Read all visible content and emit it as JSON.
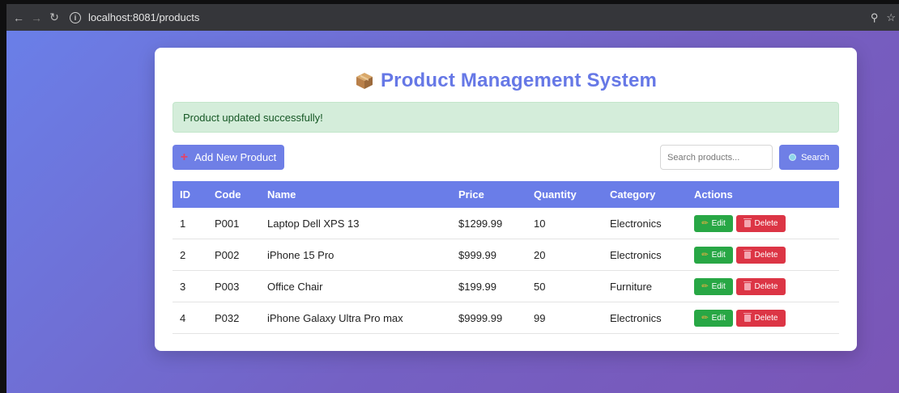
{
  "browser": {
    "url": "localhost:8081/products",
    "icons": [
      "back-arrow-icon",
      "forward-arrow-icon",
      "reload-icon",
      "info-icon",
      "zoom-icon",
      "star-icon"
    ]
  },
  "page": {
    "title": "Product Management System",
    "title_icon": "package-box-icon",
    "accent_color": "#6678e6"
  },
  "alert": {
    "message": "Product updated successfully!",
    "color": "#d4edda"
  },
  "toolbar": {
    "add_label": "Add New Product",
    "search_placeholder": "Search products...",
    "search_label": "Search"
  },
  "table": {
    "columns": [
      "ID",
      "Code",
      "Name",
      "Price",
      "Quantity",
      "Category",
      "Actions"
    ],
    "edit_label": "Edit",
    "delete_label": "Delete",
    "rows": [
      {
        "id": "1",
        "code": "P001",
        "name": "Laptop Dell XPS 13",
        "price": "$1299.99",
        "quantity": "10",
        "category": "Electronics"
      },
      {
        "id": "2",
        "code": "P002",
        "name": "iPhone 15 Pro",
        "price": "$999.99",
        "quantity": "20",
        "category": "Electronics"
      },
      {
        "id": "3",
        "code": "P003",
        "name": "Office Chair",
        "price": "$199.99",
        "quantity": "50",
        "category": "Furniture"
      },
      {
        "id": "4",
        "code": "P032",
        "name": "iPhone Galaxy Ultra Pro max",
        "price": "$9999.99",
        "quantity": "99",
        "category": "Electronics"
      }
    ]
  }
}
